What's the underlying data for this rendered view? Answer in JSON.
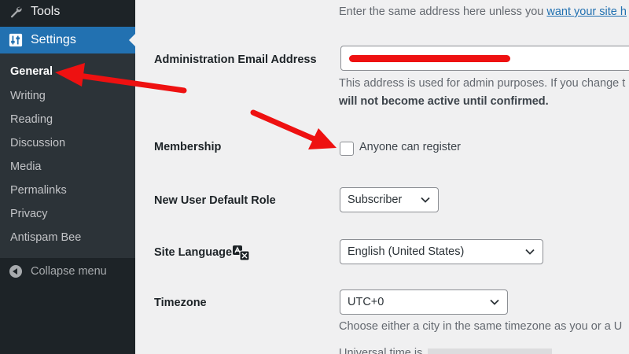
{
  "sidebar": {
    "tools_label": "Tools",
    "settings_label": "Settings",
    "items": [
      {
        "label": "General"
      },
      {
        "label": "Writing"
      },
      {
        "label": "Reading"
      },
      {
        "label": "Discussion"
      },
      {
        "label": "Media"
      },
      {
        "label": "Permalinks"
      },
      {
        "label": "Privacy"
      },
      {
        "label": "Antispam Bee"
      }
    ],
    "collapse_label": "Collapse menu"
  },
  "main": {
    "top_help_prefix": "Enter the same address here unless you ",
    "top_help_link": "want your site h",
    "admin_email": {
      "label": "Administration Email Address",
      "value": "",
      "help_line1": "This address is used for admin purposes. If you change t",
      "help_line2_bold": "will not become active until confirmed."
    },
    "membership": {
      "label": "Membership",
      "checkbox_label": "Anyone can register",
      "checked": false
    },
    "default_role": {
      "label": "New User Default Role",
      "selected": "Subscriber"
    },
    "site_language": {
      "label": "Site Language",
      "selected": "English (United States)"
    },
    "timezone": {
      "label": "Timezone",
      "selected": "UTC+0",
      "help": "Choose either a city in the same timezone as you or a U",
      "faint_label": "Universal time is"
    }
  },
  "colors": {
    "sidebar_bg": "#1d2327",
    "submenu_bg": "#2c3338",
    "accent": "#2271b1",
    "annotation": "#ee1111"
  }
}
